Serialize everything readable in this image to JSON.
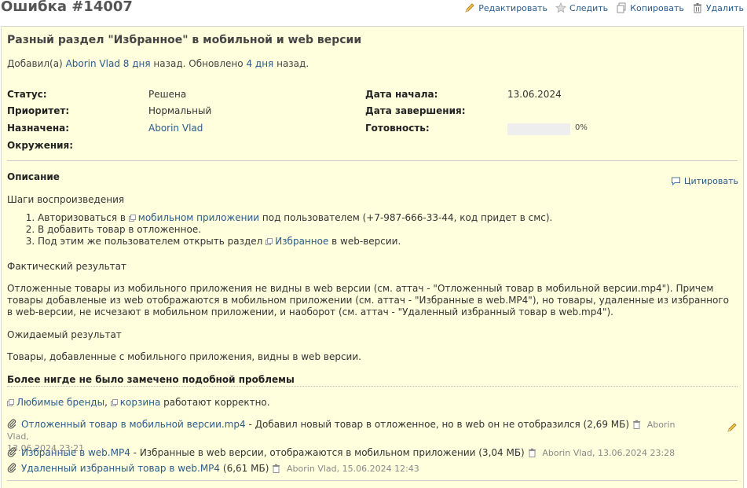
{
  "issue": {
    "title": "Ошибка #14007"
  },
  "actions": {
    "edit": "Редактировать",
    "watch": "Следить",
    "copy": "Копировать",
    "delete": "Удалить"
  },
  "subject": "Разный раздел \"Избранное\" в мобильной и web версии",
  "author_line": {
    "prefix": "Добавил(а)",
    "author": "Aborin Vlad",
    "created_ago": "8 дня",
    "mid": "назад. Обновлено",
    "updated_ago": "4 дня",
    "suffix": "назад."
  },
  "attributes": {
    "status_label": "Статус:",
    "status_value": "Решена",
    "priority_label": "Приоритет:",
    "priority_value": "Нормальный",
    "assignee_label": "Назначена:",
    "assignee_value": "Aborin Vlad",
    "environment_label": "Окружения:",
    "start_label": "Дата начала:",
    "start_value": "13.06.2024",
    "due_label": "Дата завершения:",
    "done_label": "Готовность:",
    "done_value": "0%",
    "done_ratio": 0
  },
  "description": {
    "title": "Описание",
    "quote": "Цитировать",
    "steps_title": "Шаги воспроизведения",
    "step1_a": "Авторизоваться в",
    "step1_link": "мобильном приложении",
    "step1_b": "под пользователем (+7-987-666-33-44, код придет в смс).",
    "step2": "В добавить товар в отложенное.",
    "step3_a": "Под этим же пользователем открыть раздел",
    "step3_link": "Избранное",
    "step3_b": "в web-версии.",
    "actual_title": "Фактический результат",
    "actual_text": "Отложенные товары из мобильного приложения не видны в web версии (см. аттач - \"Отложенный товар в мобильной версии.mp4\"). Причем товары добавленые из web отображаются в мобильном приложении (см. аттач - \"Избранные в web.MP4\"), но товары, удаленные из избранного в web-версии, не исчезают в мобильном приложении, и наоборот (см. аттач - \"Удаленный избранный товар в web.mp4\").",
    "expected_title": "Ожидаемый результат",
    "expected_text": "Товары, добавленные с мобильного приложения, видны в web версии.",
    "never_title": "Более нигде не было замечено подобной проблемы",
    "never_link1": "Любимые бренды",
    "never_comma": ",",
    "never_link2": "корзина",
    "never_suffix": "работают корректно."
  },
  "attachments": [
    {
      "name": "Отложенный товар в мобильной версии.mp4",
      "desc": "- Добавил новый товар в отложенное, но в web он не отобразился (2,69 МБ)",
      "meta_a": "Aborin Vlad,",
      "meta_b": "13.06.2024 23:21"
    },
    {
      "name": "Избранные в web.MP4",
      "desc": "- Избранные в web версии, отображаются в мобильном приложении (3,04 МБ)",
      "meta_a": "Aborin Vlad, 13.06.2024 23:28"
    },
    {
      "name": "Удаленный избранный товар в web.MP4",
      "desc": "(6,61 МБ)",
      "meta_a": "Aborin Vlad, 15.06.2024 12:43"
    }
  ],
  "colors": {
    "box_bg": "#ffffdd",
    "link": "#2a5b8a",
    "title": "#555555"
  }
}
